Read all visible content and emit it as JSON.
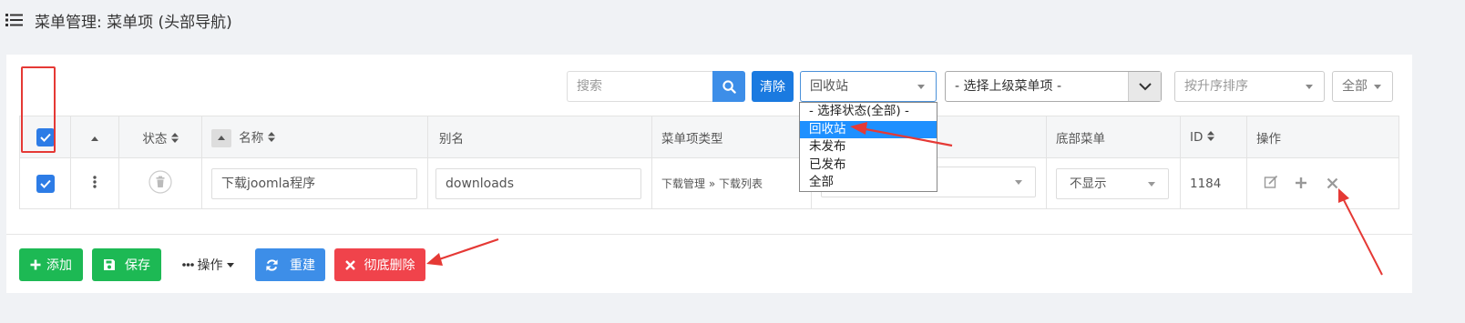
{
  "header": {
    "title": "菜单管理: 菜单项 (头部导航)"
  },
  "toolbar": {
    "search_placeholder": "搜索",
    "clear_label": "清除",
    "status_select": "回收站",
    "parent_select": "- 选择上级菜单项 -",
    "order_select": "按升序排序",
    "limit_select": "全部"
  },
  "status_dropdown": {
    "options": [
      "- 选择状态(全部) -",
      "回收站",
      "未发布",
      "已发布",
      "全部"
    ],
    "selected": "回收站"
  },
  "table": {
    "headers": {
      "status": "状态",
      "name": "名称",
      "alias": "别名",
      "type": "菜单项类型",
      "bottom_menu": "底部菜单",
      "id": "ID",
      "actions": "操作"
    },
    "rows": [
      {
        "name": "下载joomla程序",
        "alias": "downloads",
        "type": "下载管理 » 下载列表",
        "bottom_menu": "不显示",
        "id": "1184"
      }
    ]
  },
  "buttons": {
    "add": "添加",
    "save": "保存",
    "ops": "操作",
    "rebuild": "重建",
    "delete": "彻底删除"
  },
  "colors": {
    "primary": "#3d8ee8",
    "success": "#1db954",
    "danger": "#f0434b",
    "annotation": "#e53935"
  }
}
